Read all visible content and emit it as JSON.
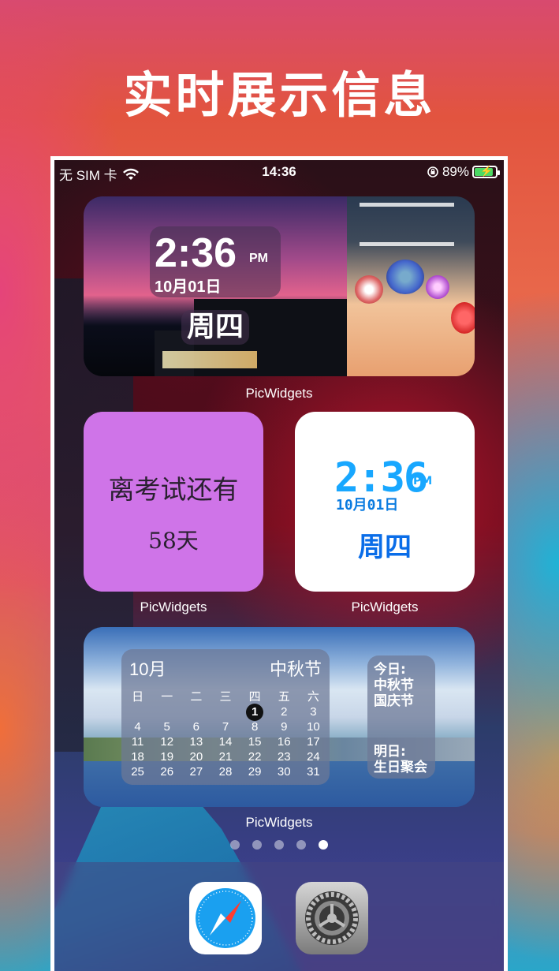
{
  "banner": {
    "title": "实时展示信息"
  },
  "status_bar": {
    "carrier": "无 SIM 卡",
    "time": "14:36",
    "battery": "89%",
    "battery_level": 0.89
  },
  "widgets": {
    "photo_clock": {
      "time": "2:36",
      "ampm": "PM",
      "date": "10月01日",
      "weekday": "周四",
      "label": "PicWidgets"
    },
    "countdown": {
      "line1": "离考试还有",
      "line2": "58天",
      "label": "PicWidgets"
    },
    "digital_clock": {
      "time": "2:36",
      "ampm": "PM",
      "date": "10月01日",
      "weekday": "周四",
      "label": "PicWidgets"
    },
    "calendar": {
      "month": "10月",
      "festival": "中秋节",
      "weekdays": [
        "日",
        "一",
        "二",
        "三",
        "四",
        "五",
        "六"
      ],
      "days": [
        "",
        "",
        "",
        "",
        "1",
        "2",
        "3",
        "4",
        "5",
        "6",
        "7",
        "8",
        "9",
        "10",
        "11",
        "12",
        "13",
        "14",
        "15",
        "16",
        "17",
        "18",
        "19",
        "20",
        "21",
        "22",
        "23",
        "24",
        "25",
        "26",
        "27",
        "28",
        "29",
        "30",
        "31"
      ],
      "today": "1",
      "today_title": "今日:",
      "today_events": [
        "中秋节",
        "国庆节"
      ],
      "tomorrow_title": "明日:",
      "tomorrow_events": [
        "生日聚会"
      ],
      "label": "PicWidgets"
    }
  },
  "page_dots": {
    "count": 5,
    "active_index": 4
  },
  "dock": {
    "apps": [
      "safari-icon",
      "settings-icon"
    ]
  },
  "colors": {
    "countdown_bg": "#cf74e8",
    "digital_accent": "#18a7ff",
    "battery_fill": "#4cd964"
  }
}
